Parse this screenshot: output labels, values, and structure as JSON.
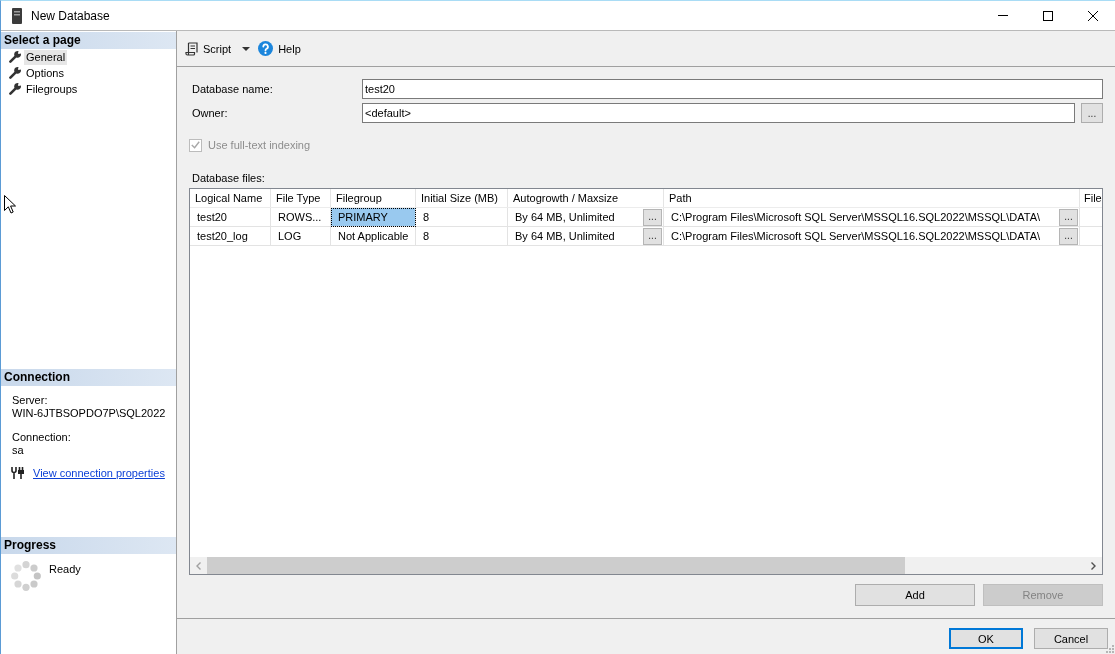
{
  "window": {
    "title": "New Database"
  },
  "sidebar": {
    "header": "Select a page",
    "items": [
      {
        "label": "General",
        "selected": true
      },
      {
        "label": "Options",
        "selected": false
      },
      {
        "label": "Filegroups",
        "selected": false
      }
    ]
  },
  "connection": {
    "header": "Connection",
    "fields": [
      {
        "label": "Server:",
        "value": "WIN-6JTBSOPDO7P\\SQL2022"
      },
      {
        "label": "Connection:",
        "value": "sa"
      }
    ],
    "link": "View connection properties"
  },
  "progress": {
    "header": "Progress",
    "status": "Ready"
  },
  "toolbar": {
    "items": [
      {
        "kind": "dropdown",
        "label": "Script"
      },
      {
        "kind": "help",
        "label": "Help"
      }
    ]
  },
  "form": {
    "fields": [
      {
        "label": "Database name:",
        "value": "test20"
      },
      {
        "label": "Owner:",
        "value": "<default>",
        "button": "..."
      }
    ],
    "full_text_indexing": {
      "label": "Use full-text indexing",
      "checked": true,
      "disabled": true
    }
  },
  "database_files": {
    "label": "Database files:",
    "columns": [
      "Logical Name",
      "File Type",
      "Filegroup",
      "Initial Size (MB)",
      "Autogrowth / Maxsize",
      "Path",
      "File"
    ],
    "rows": [
      {
        "cells": [
          {
            "text": "test20",
            "selected": false
          },
          {
            "text": "ROWS...",
            "selected": false
          },
          {
            "text": "PRIMARY",
            "selected": true
          },
          {
            "text": "8",
            "selected": false
          },
          {
            "text": "By 64 MB, Unlimited",
            "selected": false,
            "button": "..."
          },
          {
            "text": "C:\\Program Files\\Microsoft SQL Server\\MSSQL16.SQL2022\\MSSQL\\DATA\\",
            "selected": false,
            "button": "..."
          }
        ]
      },
      {
        "cells": [
          {
            "text": "test20_log",
            "selected": false
          },
          {
            "text": "LOG",
            "selected": false
          },
          {
            "text": "Not Applicable",
            "selected": false
          },
          {
            "text": "8",
            "selected": false
          },
          {
            "text": "By 64 MB, Unlimited",
            "selected": false,
            "button": "..."
          },
          {
            "text": "C:\\Program Files\\Microsoft SQL Server\\MSSQL16.SQL2022\\MSSQL\\DATA\\",
            "selected": false,
            "button": "..."
          }
        ]
      }
    ]
  },
  "file_buttons": [
    {
      "label": "Add",
      "disabled": false
    },
    {
      "label": "Remove",
      "disabled": true
    }
  ],
  "dialog_buttons": [
    {
      "label": "OK",
      "default": true
    },
    {
      "label": "Cancel",
      "default": false
    }
  ]
}
